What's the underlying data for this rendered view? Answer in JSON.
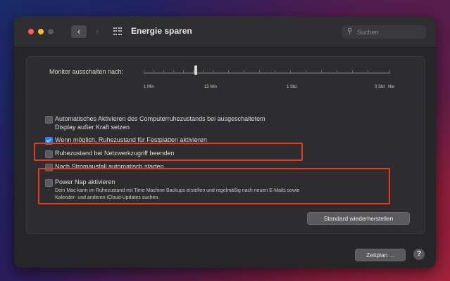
{
  "window": {
    "title": "Energie sparen",
    "search_placeholder": "Suchen"
  },
  "slider": {
    "label": "Monitor ausschalten nach:",
    "tick_labels": [
      "1 Min",
      "15 Min",
      "1 Std",
      "3 Std",
      "Nie"
    ]
  },
  "options": [
    {
      "line1": "Automatisches Aktivieren des Computerruhezustands bei ausgeschaltetem",
      "line2": "Display außer Kraft setzen",
      "checked": false
    },
    {
      "line1": "Wenn möglich, Ruhezustand für Festplatten aktivieren",
      "checked": true
    },
    {
      "line1": "Ruhezustand bei Netzwerkzugriff beenden",
      "checked": false
    },
    {
      "line1": "Nach Stromausfall automatisch starten",
      "checked": false
    },
    {
      "line1": "Power Nap aktivieren",
      "checked": false
    }
  ],
  "power_nap_desc": {
    "line1": "Dein Mac kann im Ruhezustand mit Time Machine Backups erstellen und regelmäßig nach neuen E-Mails sowie",
    "line2": "Kalender- und anderen iCloud-Updates suchen."
  },
  "buttons": {
    "restore": "Standard wiederherstellen",
    "schedule": "Zeitplan ...",
    "help": "?"
  },
  "colors": {
    "highlight": "#ea3a12",
    "accent": "#2f7df6"
  }
}
